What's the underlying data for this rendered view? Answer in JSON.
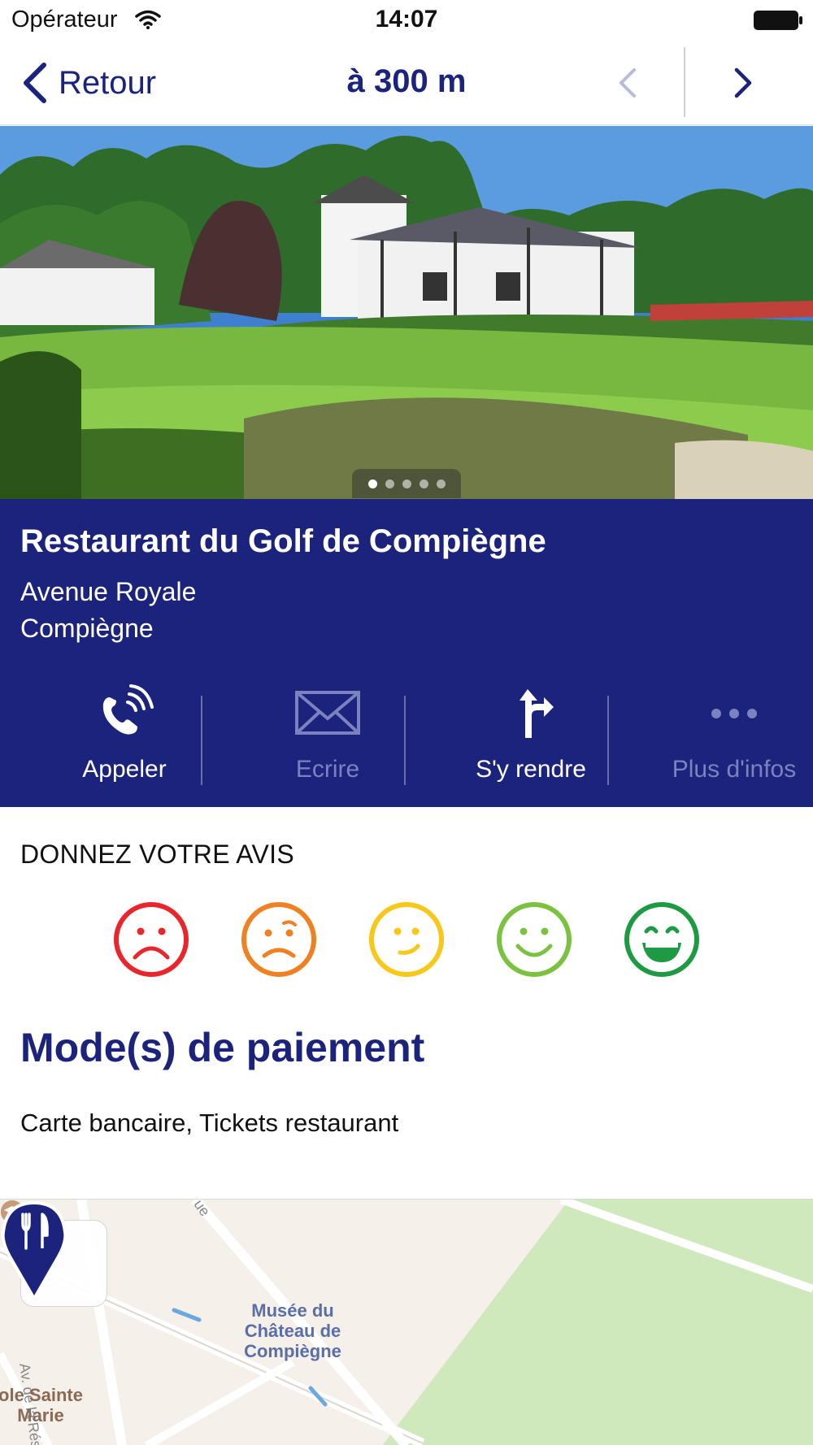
{
  "status_bar": {
    "carrier": "Opérateur",
    "time": "14:07",
    "wifi_icon": "wifi-icon",
    "battery_icon": "battery-icon"
  },
  "nav": {
    "back_label": "Retour",
    "title": "à 300 m",
    "prev_icon": "chevron-left-icon",
    "next_icon": "chevron-right-icon"
  },
  "gallery": {
    "photo_description_icon": "photo",
    "page_count": 5,
    "active_page": 1
  },
  "place": {
    "name": "Restaurant du Golf de Compiègne",
    "address_line1": "Avenue Royale",
    "address_line2": "Compiègne"
  },
  "actions": [
    {
      "label": "Appeler",
      "icon": "phone-icon",
      "enabled": true
    },
    {
      "label": "Ecrire",
      "icon": "mail-icon",
      "enabled": false
    },
    {
      "label": "S'y rendre",
      "icon": "directions-icon",
      "enabled": true
    },
    {
      "label": "Plus d'infos",
      "icon": "more-icon",
      "enabled": false
    }
  ],
  "rating": {
    "title": "DONNEZ VOTRE AVIS",
    "options": [
      {
        "icon": "very-sad-face-icon",
        "color": "#e8262c"
      },
      {
        "icon": "sad-face-icon",
        "color": "#f08123"
      },
      {
        "icon": "neutral-face-icon",
        "color": "#f7c719"
      },
      {
        "icon": "smile-face-icon",
        "color": "#7cc241"
      },
      {
        "icon": "laugh-face-icon",
        "color": "#1d9a42"
      }
    ]
  },
  "payment": {
    "title": "Mode(s) de paiement",
    "text": "Carte bancaire, Tickets restaurant"
  },
  "map": {
    "museum_label": "Musée du Château de Compiègne",
    "school_label": "ole Sainte Marie",
    "street_label": "Av. de la Résistance",
    "street_label_top": "ue",
    "expand_icon": "expand-icon",
    "pin_icon": "restaurant-pin-icon"
  },
  "colors": {
    "brand_blue": "#1b237d",
    "link_blue": "#1a237e",
    "disabled_action": "#7b82bf"
  }
}
